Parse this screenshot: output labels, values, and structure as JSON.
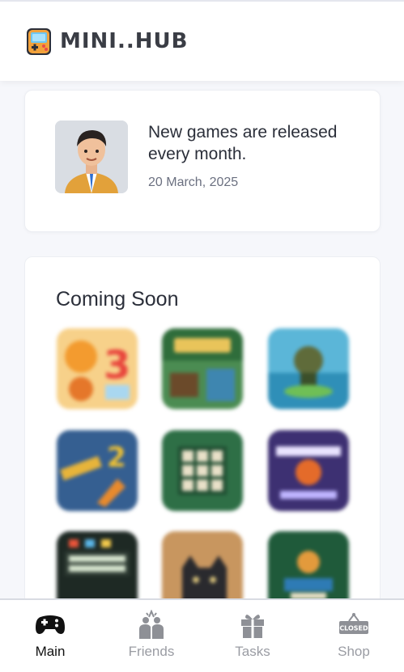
{
  "app": {
    "brand": "MINI..HUB"
  },
  "news": {
    "title": "New games are released every month.",
    "date": "20 March, 2025"
  },
  "coming_soon": {
    "title": "Coming Soon",
    "games": [
      {
        "name": "game-tile-1",
        "color": "#f6c978"
      },
      {
        "name": "game-tile-2",
        "color": "#3f7c4a"
      },
      {
        "name": "game-tile-3",
        "color": "#4aa6c9"
      },
      {
        "name": "game-tile-4",
        "color": "#2f5a8c"
      },
      {
        "name": "game-tile-5",
        "color": "#2d6b43"
      },
      {
        "name": "game-tile-6",
        "color": "#3b2f6b"
      },
      {
        "name": "game-tile-7",
        "color": "#1f2a22"
      },
      {
        "name": "game-tile-8",
        "color": "#c89560"
      },
      {
        "name": "game-tile-9",
        "color": "#245a3b"
      }
    ]
  },
  "nav": {
    "items": [
      {
        "label": "Main",
        "icon": "gamepad-icon",
        "active": true
      },
      {
        "label": "Friends",
        "icon": "friends-icon",
        "active": false
      },
      {
        "label": "Tasks",
        "icon": "gift-icon",
        "active": false
      },
      {
        "label": "Shop",
        "icon": "shop-closed-icon",
        "active": false
      }
    ],
    "shop_sign_text": "CLOSED"
  },
  "colors": {
    "accent": "#2b2f3a",
    "muted": "#9a9ca3",
    "background": "#f6f7fb"
  }
}
